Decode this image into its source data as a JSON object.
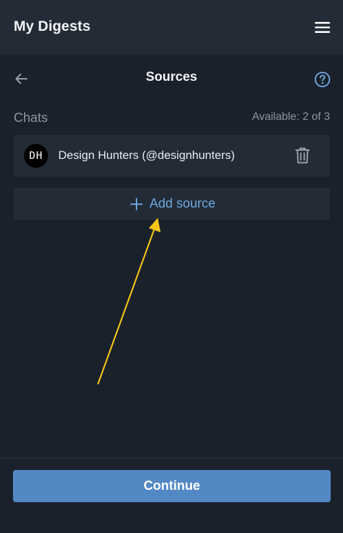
{
  "header": {
    "title": "My Digests",
    "menu_icon": "menu-icon"
  },
  "nav": {
    "back_icon": "arrow-left-icon",
    "title": "Sources",
    "help_icon": "help-circle-icon"
  },
  "section": {
    "label": "Chats",
    "available": "Available: 2 of 3"
  },
  "sources": [
    {
      "avatar_text": "DH",
      "name": "Design Hunters (@designhunters)",
      "delete_icon": "trash-icon"
    }
  ],
  "add_source": {
    "icon": "plus-icon",
    "label": "Add source"
  },
  "footer": {
    "continue_label": "Continue"
  },
  "colors": {
    "background": "#1a212b",
    "surface": "#232b36",
    "accent_blue": "#6fa8df",
    "primary_button": "#5289c4",
    "muted_text": "#8c96a3",
    "annotation_arrow": "#f5c518"
  }
}
